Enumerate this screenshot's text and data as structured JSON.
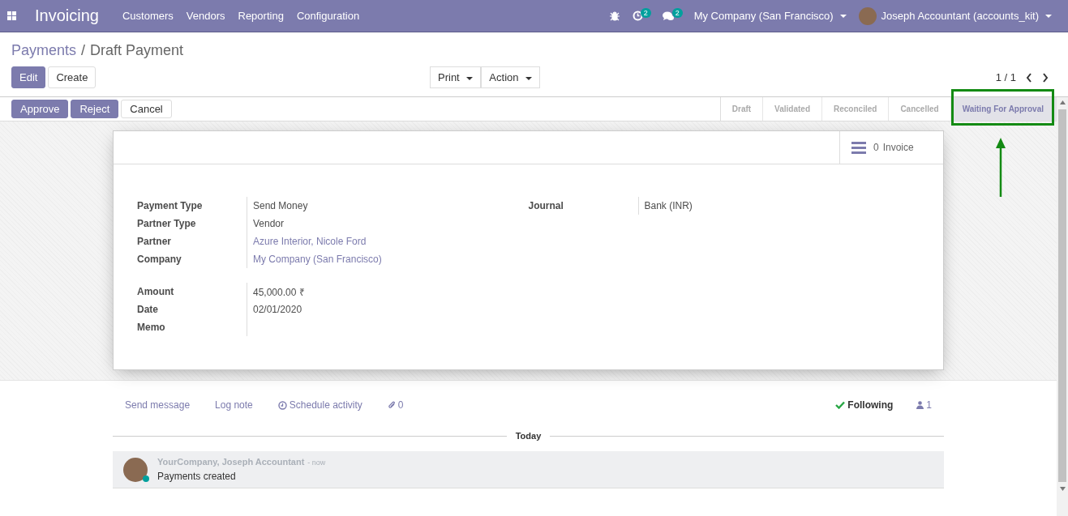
{
  "navbar": {
    "app_title": "Invoicing",
    "menu": [
      "Customers",
      "Vendors",
      "Reporting",
      "Configuration"
    ],
    "activity_count": "2",
    "message_count": "2",
    "company": "My Company (San Francisco)",
    "user": "Joseph Accountant (accounts_kit)"
  },
  "breadcrumb_separator": "/",
  "breadcrumb": [
    {
      "label": "Payments",
      "kind": "link"
    },
    {
      "label": "Draft Payment",
      "kind": "current"
    }
  ],
  "buttons": [
    {
      "label": "Edit",
      "kind": "primary"
    },
    {
      "label": "Create",
      "kind": "secondary"
    }
  ],
  "dropdowns": [
    "Print",
    "Action"
  ],
  "pager": "1 / 1",
  "header_buttons": [
    {
      "label": "Approve",
      "kind": "primary"
    },
    {
      "label": "Reject",
      "kind": "primary"
    },
    {
      "label": "Cancel",
      "kind": "secondary"
    }
  ],
  "stages": [
    {
      "label": "Draft",
      "selected": false
    },
    {
      "label": "Validated",
      "selected": false
    },
    {
      "label": "Reconciled",
      "selected": false
    },
    {
      "label": "Cancelled",
      "selected": false
    },
    {
      "label": "Waiting For Approval",
      "selected": true
    }
  ],
  "smart_button": {
    "count": "0",
    "label": "Invoice"
  },
  "left_groups": [
    [
      {
        "label": "Payment Type",
        "value": "Send Money",
        "kind": "text"
      },
      {
        "label": "Partner Type",
        "value": "Vendor",
        "kind": "text"
      },
      {
        "label": "Partner",
        "value": "Azure Interior, Nicole Ford",
        "kind": "link"
      },
      {
        "label": "Company",
        "value": "My Company (San Francisco)",
        "kind": "link"
      }
    ],
    [
      {
        "label": "Amount",
        "value": "45,000.00 ₹",
        "kind": "text"
      },
      {
        "label": "Date",
        "value": "02/01/2020",
        "kind": "text"
      },
      {
        "label": "Memo"
      }
    ]
  ],
  "right_fields": [
    {
      "label": "Journal",
      "value": "Bank (INR)",
      "kind": "text"
    }
  ],
  "chatter": {
    "actions": [
      {
        "label": "Send message",
        "kind": "plain"
      },
      {
        "label": "Log note",
        "kind": "plain"
      },
      {
        "label": "Schedule activity",
        "kind": "clock"
      }
    ],
    "attachments": "0",
    "following": "Following",
    "followers": "1",
    "date_separator": "Today",
    "messages": [
      {
        "author": "YourCompany, Joseph Accountant",
        "time": "- now",
        "body": "Payments created",
        "online": true
      }
    ]
  }
}
